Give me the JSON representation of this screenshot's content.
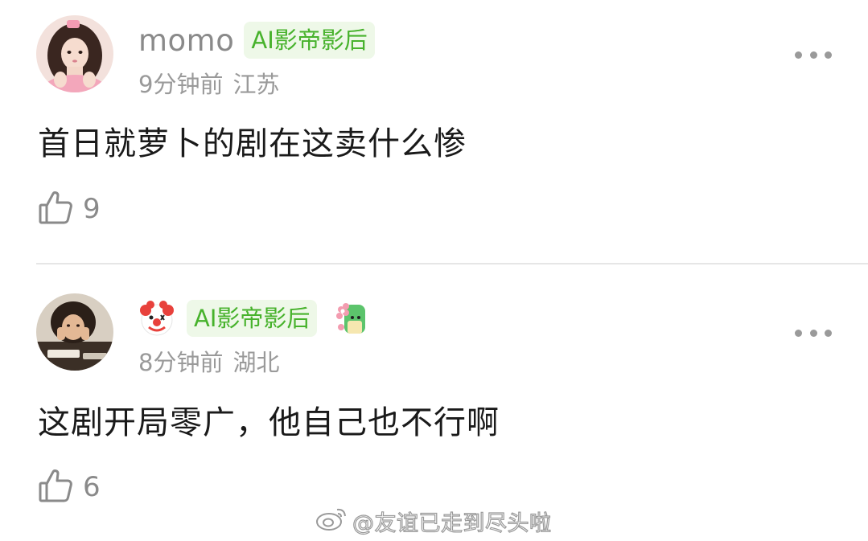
{
  "comments": [
    {
      "username": "momo",
      "badge": "AI影帝影后",
      "time": "9分钟前",
      "location": "江苏",
      "text": "首日就萝卜的剧在这卖什么惨",
      "likes": "9"
    },
    {
      "username": "",
      "badge": "AI影帝影后",
      "time": "8分钟前",
      "location": "湖北",
      "text": "这剧开局零广，他自己也不行啊",
      "likes": "6"
    }
  ],
  "watermark": {
    "text": "@友谊已走到尽头啦"
  },
  "icons": {
    "like": "thumbs-up-icon",
    "more": "more-dots-icon",
    "clown": "clown-face-icon",
    "sticker": "flower-sticker-icon",
    "weibo": "weibo-logo-icon"
  },
  "colors": {
    "badge_text": "#47b22c",
    "badge_bg": "#eef8e8",
    "secondary_text": "#8a8a8a",
    "divider": "#e6e6e6"
  }
}
